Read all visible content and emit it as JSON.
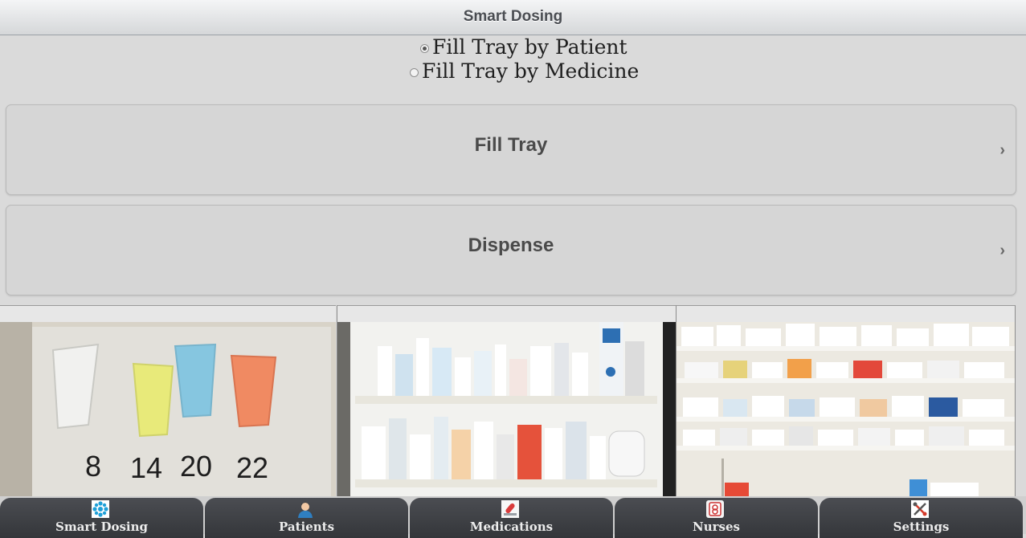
{
  "header": {
    "title": "Smart Dosing"
  },
  "fill_mode": {
    "options": [
      {
        "label": "Fill Tray by Patient",
        "selected": true
      },
      {
        "label": "Fill Tray by Medicine",
        "selected": false
      }
    ]
  },
  "actions": [
    {
      "label": "Fill Tray",
      "icon": "chevron-right-icon"
    },
    {
      "label": "Dispense",
      "icon": "chevron-right-icon"
    }
  ],
  "gallery": {
    "images": [
      {
        "name": "dose-cups-photo",
        "labels": [
          "8",
          "14",
          "20",
          "22"
        ]
      },
      {
        "name": "medicine-cabinet-photo"
      },
      {
        "name": "pharmacy-shelves-photo"
      }
    ]
  },
  "tabbar": {
    "tabs": [
      {
        "label": "Smart Dosing",
        "icon": "smart-dosing-icon"
      },
      {
        "label": "Patients",
        "icon": "patient-icon"
      },
      {
        "label": "Medications",
        "icon": "medication-icon"
      },
      {
        "label": "Nurses",
        "icon": "nurse-icon"
      },
      {
        "label": "Settings",
        "icon": "settings-icon"
      }
    ]
  },
  "colors": {
    "accent": "#3a3c40",
    "background": "#dadada"
  }
}
